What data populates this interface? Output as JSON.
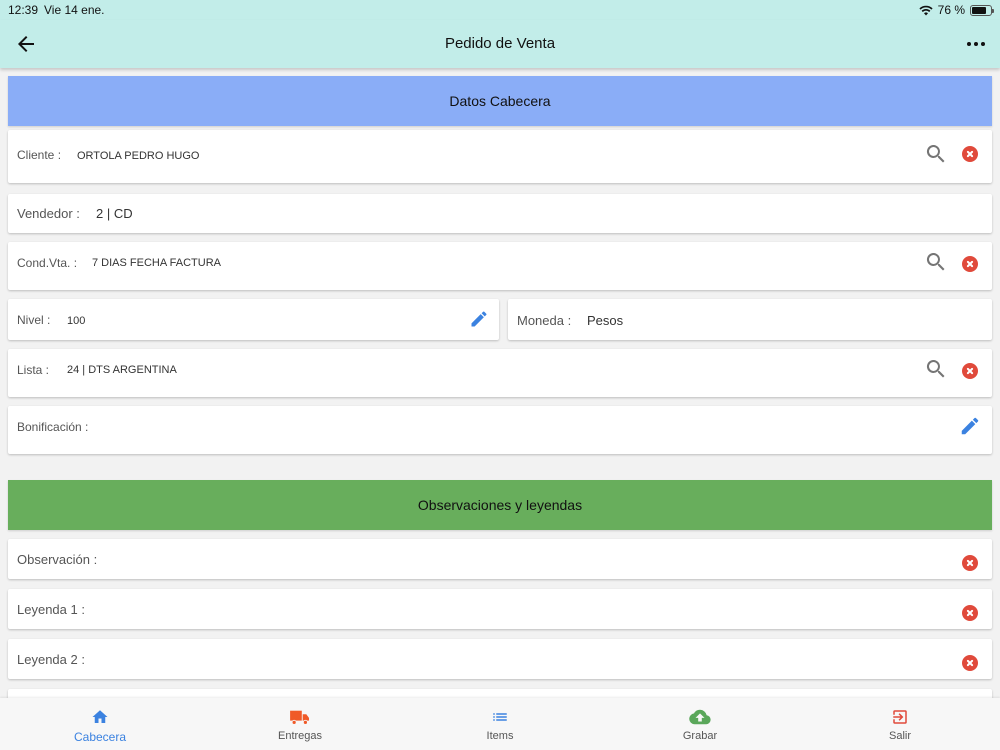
{
  "statusbar": {
    "time": "12:39",
    "date": "Vie 14 ene.",
    "battery": "76 %",
    "battery_level": 0.76
  },
  "appbar": {
    "title": "Pedido de Venta"
  },
  "sections": {
    "header": {
      "title": "Datos Cabecera",
      "color": "#8aadf7"
    },
    "observations": {
      "title": "Observaciones y leyendas",
      "color": "#68ae5c"
    }
  },
  "fields": {
    "cliente": {
      "label": "Cliente :",
      "value": "ORTOLA PEDRO HUGO"
    },
    "vendedor": {
      "label": "Vendedor :",
      "value": "2 | CD"
    },
    "cond_vta": {
      "label": "Cond.Vta. :",
      "value": "7 DIAS FECHA FACTURA"
    },
    "nivel": {
      "label": "Nivel :",
      "value": "100"
    },
    "moneda": {
      "label": "Moneda :",
      "value": "Pesos"
    },
    "lista": {
      "label": "Lista :",
      "value": "24 | DTS ARGENTINA"
    },
    "bonificacion": {
      "label": "Bonificación :",
      "value": ""
    },
    "observacion": {
      "label": "Observación :",
      "value": ""
    },
    "leyenda1": {
      "label": "Leyenda 1 :",
      "value": ""
    },
    "leyenda2": {
      "label": "Leyenda 2 :",
      "value": ""
    }
  },
  "colors": {
    "accent": "#3b82e0",
    "clear": "#e04a3b",
    "appbar": "#c2ede9",
    "truck": "#f05a28",
    "upload": "#5aa75a",
    "exit": "#e04a3b"
  },
  "bottom_nav": [
    {
      "label": "Cabecera",
      "icon": "home-icon",
      "active": true
    },
    {
      "label": "Entregas",
      "icon": "truck-icon",
      "active": false
    },
    {
      "label": "Items",
      "icon": "list-icon",
      "active": false
    },
    {
      "label": "Grabar",
      "icon": "cloud-upload-icon",
      "active": false
    },
    {
      "label": "Salir",
      "icon": "exit-icon",
      "active": false
    }
  ]
}
